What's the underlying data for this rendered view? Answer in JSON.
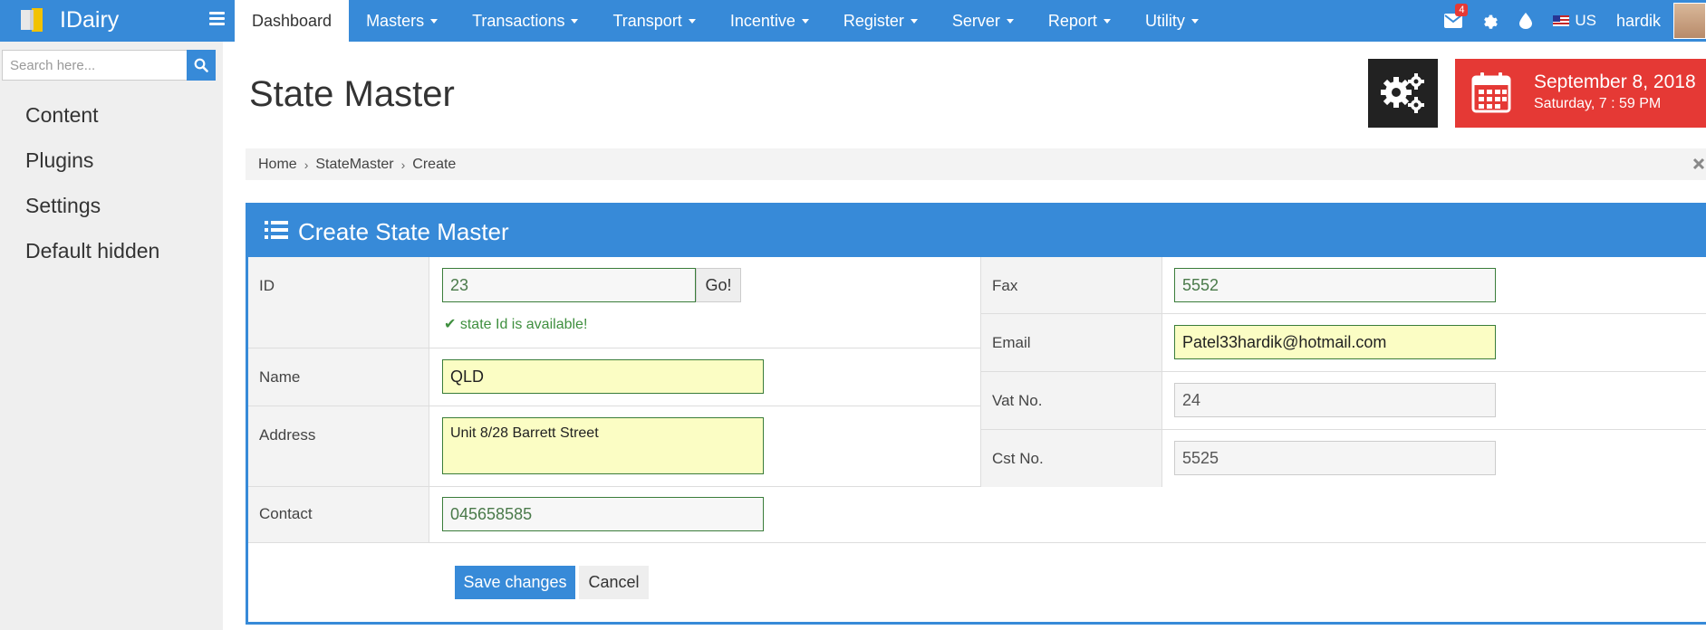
{
  "app": {
    "brand": "IDairy"
  },
  "nav": {
    "items": [
      {
        "label": "Dashboard",
        "dropdown": false,
        "active": true
      },
      {
        "label": "Masters",
        "dropdown": true
      },
      {
        "label": "Transactions",
        "dropdown": true
      },
      {
        "label": "Transport",
        "dropdown": true
      },
      {
        "label": "Incentive",
        "dropdown": true
      },
      {
        "label": "Register",
        "dropdown": true
      },
      {
        "label": "Server",
        "dropdown": true
      },
      {
        "label": "Report",
        "dropdown": true
      },
      {
        "label": "Utility",
        "dropdown": true
      }
    ],
    "mail_badge": "4",
    "language": "US",
    "user": "hardik"
  },
  "sidebar": {
    "search_placeholder": "Search here...",
    "links": [
      "Content",
      "Plugins",
      "Settings",
      "Default hidden"
    ]
  },
  "page": {
    "title": "State Master",
    "date": "September 8, 2018",
    "day_time": "Saturday, 7 : 59 PM"
  },
  "breadcrumb": [
    "Home",
    "StateMaster",
    "Create"
  ],
  "form": {
    "title": "Create State Master",
    "id_label": "ID",
    "id_value": "23",
    "go_label": "Go!",
    "id_status": "state Id is available!",
    "name_label": "Name",
    "name_value": "QLD",
    "address_label": "Address",
    "address_value": "Unit 8/28 Barrett Street",
    "contact_label": "Contact",
    "contact_value": "045658585",
    "fax_label": "Fax",
    "fax_value": "5552",
    "email_label": "Email",
    "email_value": "Patel33hardik@hotmail.com",
    "vat_label": "Vat No.",
    "vat_value": "24",
    "cst_label": "Cst No.",
    "cst_value": "5525",
    "save_label": "Save changes",
    "cancel_label": "Cancel"
  },
  "colors": {
    "primary": "#378ad8",
    "danger": "#e53935",
    "dark_tile": "#222222",
    "valid": "#3f8f3f"
  }
}
